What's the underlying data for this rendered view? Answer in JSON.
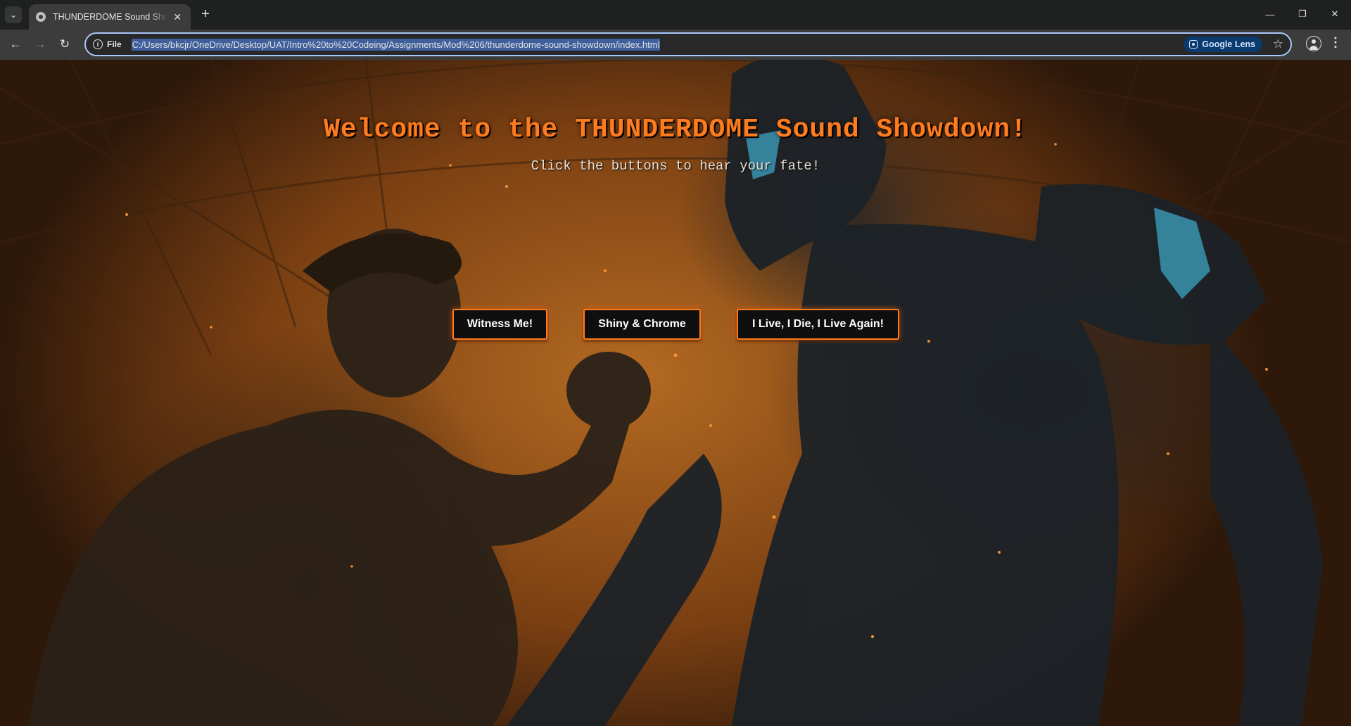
{
  "browser": {
    "tab": {
      "title": "THUNDERDOME Sound Showdown",
      "favicon": "globe-icon"
    },
    "omnibox": {
      "scheme_label": "File",
      "url": "C:/Users/bkcjr/OneDrive/Desktop/UAT/Intro%20to%20Codeing/Assignments/Mod%206/thunderdome-sound-showdown/index.html",
      "lens_label": "Google Lens"
    },
    "icons": {
      "tab_search": "chevron-down-icon",
      "new_tab": "plus-icon",
      "back": "arrow-left-icon",
      "forward": "arrow-right-icon",
      "reload": "reload-icon",
      "bookmark": "star-icon",
      "profile": "profile-icon",
      "menu": "kebab-menu-icon"
    }
  },
  "page": {
    "headline": "Welcome to the THUNDERDOME Sound Showdown!",
    "subline": "Click the buttons to hear your fate!",
    "buttons": [
      {
        "label": "Witness Me!"
      },
      {
        "label": "Shiny & Chrome"
      },
      {
        "label": "I Live, I Die, I Live Again!"
      }
    ],
    "colors": {
      "accent": "#ff7b1f",
      "button_bg": "#0f0f0f",
      "button_text": "#ffffff",
      "background_base": "#b36a22"
    },
    "background_image": "wasteland-man-vs-robot-illustration"
  }
}
